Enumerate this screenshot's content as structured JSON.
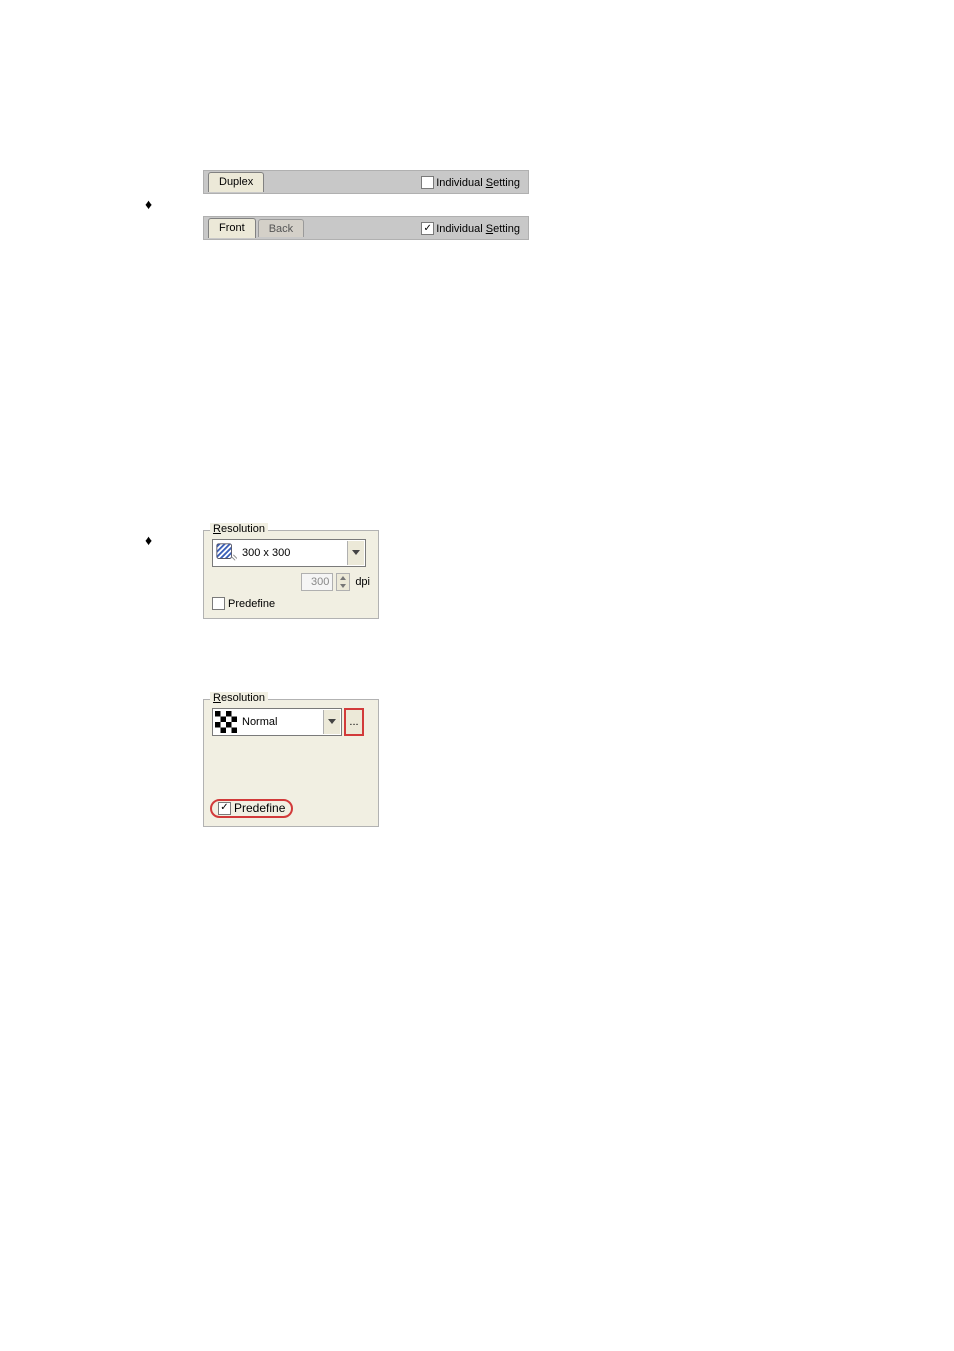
{
  "tabstrip1": {
    "tab_duplex": "Duplex",
    "individual_setting_label_html": "Individual <u>S</u>etting",
    "individual_setting_label": "Individual Setting",
    "individual_setting_checked": false
  },
  "tabstrip2": {
    "tab_front": "Front",
    "tab_back": "Back",
    "individual_setting_label_html": "Individual <u>S</u>etting",
    "individual_setting_label": "Individual Setting",
    "individual_setting_checked": true
  },
  "resolution1": {
    "legend_html": "<u>R</u>esolution",
    "legend": "Resolution",
    "value": "300 x 300",
    "dpi_value": "300",
    "dpi_label": "dpi",
    "predefine_label": "Predefine",
    "predefine_checked": false
  },
  "resolution2": {
    "legend_html": "<u>R</u>esolution",
    "legend": "Resolution",
    "value": "Normal",
    "more_button": "...",
    "predefine_label": "Predefine",
    "predefine_checked": true
  }
}
